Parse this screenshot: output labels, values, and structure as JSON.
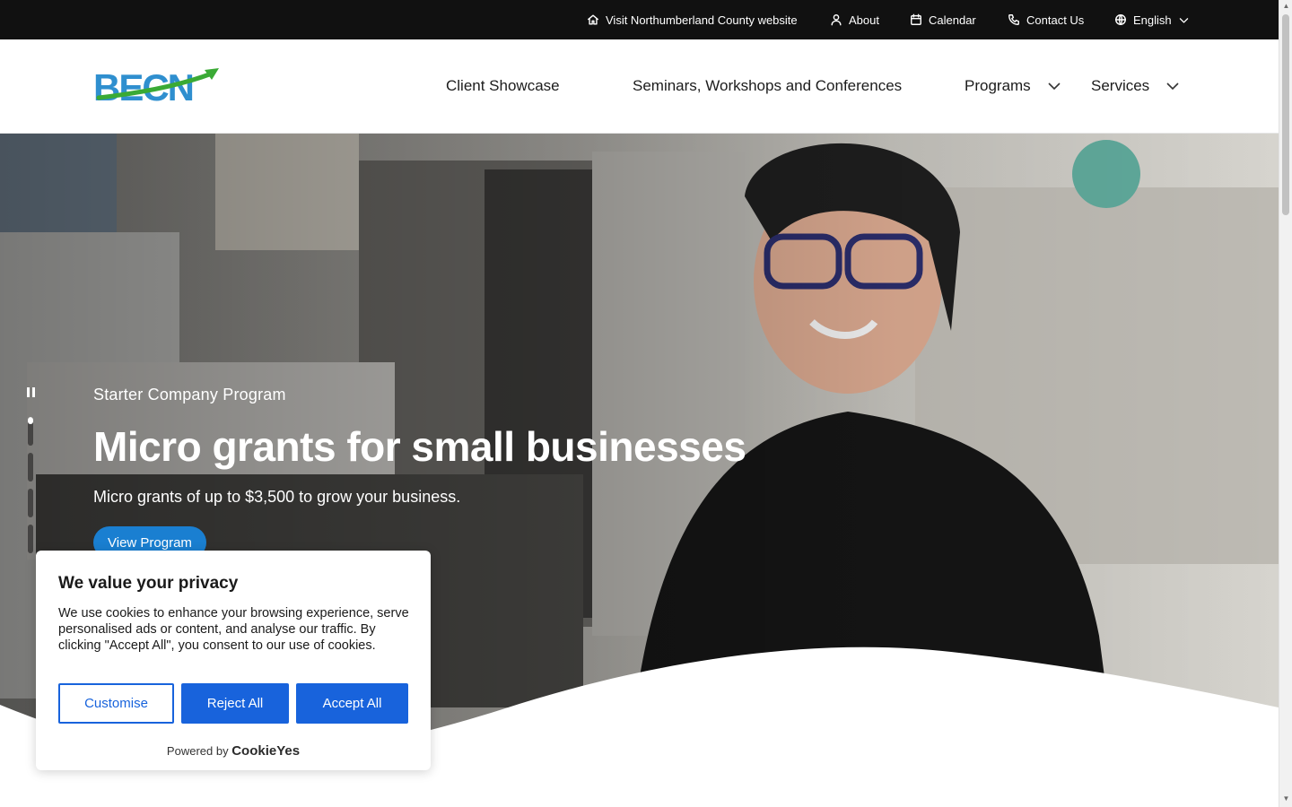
{
  "utility_bar": {
    "county_label": "Visit Northumberland County website",
    "about_label": "About",
    "calendar_label": "Calendar",
    "contact_label": "Contact Us",
    "language_label": "English"
  },
  "header": {
    "logo_text": "BECN",
    "nav": [
      {
        "label": "Client Showcase"
      },
      {
        "label": "Seminars, Workshops and Conferences"
      },
      {
        "label": "Programs"
      },
      {
        "label": "Services"
      }
    ]
  },
  "hero": {
    "eyebrow": "Starter Company Program",
    "title": "Micro grants for small businesses",
    "subtitle": "Micro grants of up to $3,500 to grow your business.",
    "button_label": "View Program",
    "slides": [
      {
        "progress": 0.25
      },
      {
        "progress": 0
      },
      {
        "progress": 0
      },
      {
        "progress": 0
      }
    ]
  },
  "cookie_banner": {
    "title": "We value your privacy",
    "text": "We use cookies to enhance your browsing experience, serve personalised ads or content, and analyse our traffic. By clicking \"Accept All\", you consent to our use of cookies.",
    "customise_label": "Customise",
    "reject_label": "Reject All",
    "accept_label": "Accept All",
    "powered_by": "Powered by",
    "brand": "CookieYes"
  },
  "colors": {
    "utility_bg": "#111111",
    "accent_blue": "#1863dc",
    "hero_button": "#1a7fd1",
    "logo_blue": "#2f8fcf",
    "logo_green": "#3aaa35"
  }
}
